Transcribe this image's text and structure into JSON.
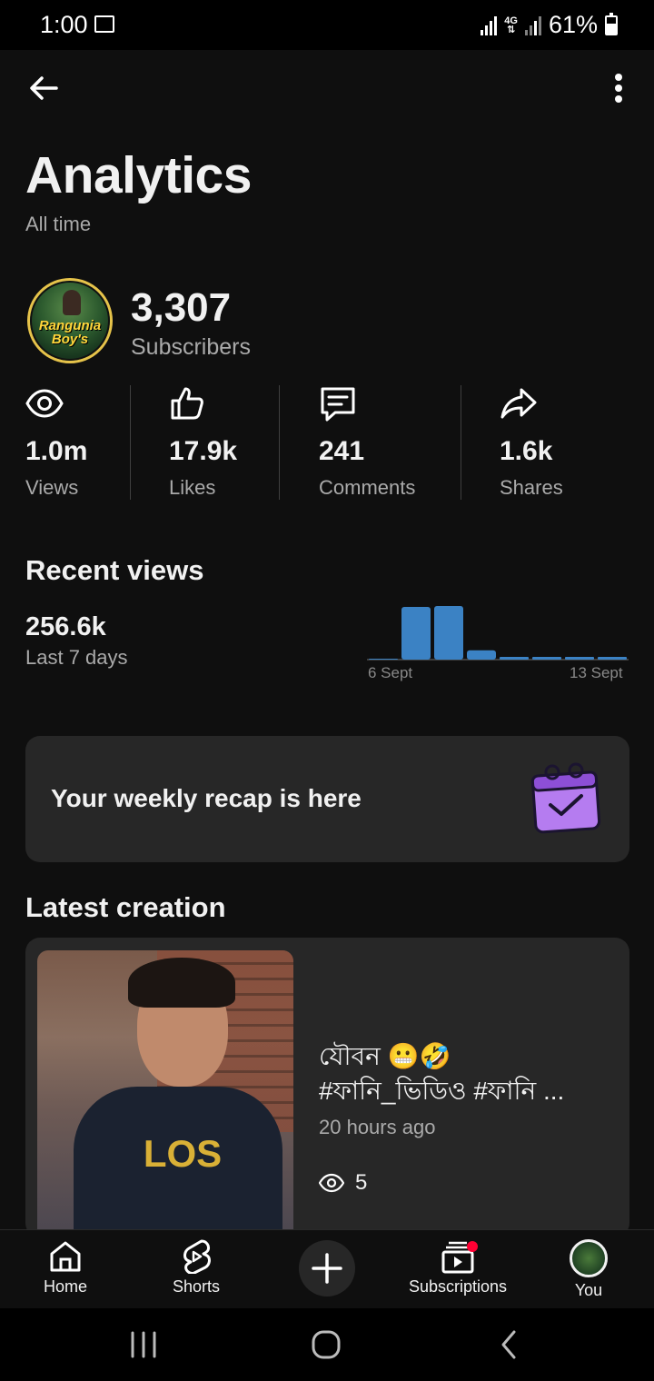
{
  "status_bar": {
    "time": "1:00",
    "network": "4G",
    "battery": "61%"
  },
  "header": {
    "title": "Analytics",
    "subtitle": "All time"
  },
  "channel": {
    "subscriber_count": "3,307",
    "subscriber_label": "Subscribers",
    "logo_text": "Rangunia Boy's"
  },
  "stats": [
    {
      "value": "1.0m",
      "label": "Views",
      "icon": "eye-icon"
    },
    {
      "value": "17.9k",
      "label": "Likes",
      "icon": "thumbs-up-icon"
    },
    {
      "value": "241",
      "label": "Comments",
      "icon": "comment-icon"
    },
    {
      "value": "1.6k",
      "label": "Shares",
      "icon": "share-icon"
    }
  ],
  "recent_views": {
    "title": "Recent views",
    "value": "256.6k",
    "period": "Last 7 days",
    "start_label": "6 Sept",
    "end_label": "13 Sept"
  },
  "chart_data": {
    "type": "bar",
    "categories": [
      "",
      "",
      "",
      "",
      "",
      "",
      "",
      ""
    ],
    "values": [
      0,
      117,
      119,
      19,
      1,
      1,
      1,
      1
    ],
    "x_tick_labels": [
      "6 Sept",
      "13 Sept"
    ],
    "accent_color": "#3b82c4"
  },
  "recap": {
    "text": "Your weekly recap is here",
    "icon": "calendar-check-icon",
    "icon_color": "#b57cf0"
  },
  "latest_creation": {
    "title": "Latest creation",
    "video_title_line1": "যৌবন 😬🤣",
    "video_title_line2": "#ফানি_ভিডিও #ফানি ...",
    "thumbnail_text": "LOS",
    "time_ago": "20 hours ago",
    "views": "5"
  },
  "bottom_nav": {
    "home": "Home",
    "shorts": "Shorts",
    "subscriptions": "Subscriptions",
    "you": "You"
  }
}
